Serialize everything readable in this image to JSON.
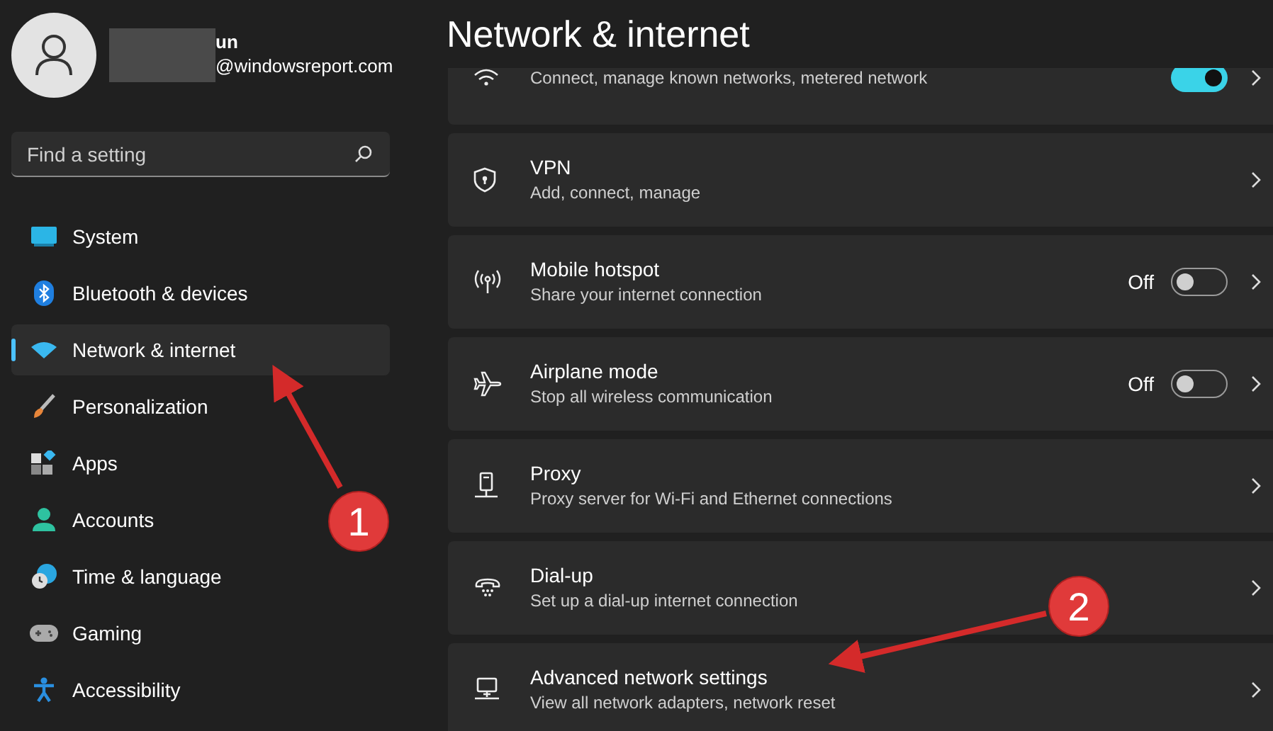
{
  "account": {
    "name_visible": "un",
    "email": "@windowsreport.com"
  },
  "search": {
    "placeholder": "Find a setting"
  },
  "nav": [
    {
      "label": "System",
      "selected": false
    },
    {
      "label": "Bluetooth & devices",
      "selected": false
    },
    {
      "label": "Network & internet",
      "selected": true
    },
    {
      "label": "Personalization",
      "selected": false
    },
    {
      "label": "Apps",
      "selected": false
    },
    {
      "label": "Accounts",
      "selected": false
    },
    {
      "label": "Time & language",
      "selected": false
    },
    {
      "label": "Gaming",
      "selected": false
    },
    {
      "label": "Accessibility",
      "selected": false
    }
  ],
  "page_title": "Network & internet",
  "settings": [
    {
      "kind": "toggle",
      "subtitle": "Connect, manage known networks, metered network",
      "on": true
    },
    {
      "kind": "link",
      "title": "VPN",
      "subtitle": "Add, connect, manage"
    },
    {
      "kind": "toggle",
      "title": "Mobile hotspot",
      "subtitle": "Share your internet connection",
      "toggle_label": "Off",
      "on": false
    },
    {
      "kind": "toggle",
      "title": "Airplane mode",
      "subtitle": "Stop all wireless communication",
      "toggle_label": "Off",
      "on": false
    },
    {
      "kind": "link",
      "title": "Proxy",
      "subtitle": "Proxy server for Wi-Fi and Ethernet connections"
    },
    {
      "kind": "link",
      "title": "Dial-up",
      "subtitle": "Set up a dial-up internet connection"
    },
    {
      "kind": "link",
      "title": "Advanced network settings",
      "subtitle": "View all network adapters, network reset"
    }
  ],
  "annotations": [
    {
      "label": "1"
    },
    {
      "label": "2"
    }
  ]
}
